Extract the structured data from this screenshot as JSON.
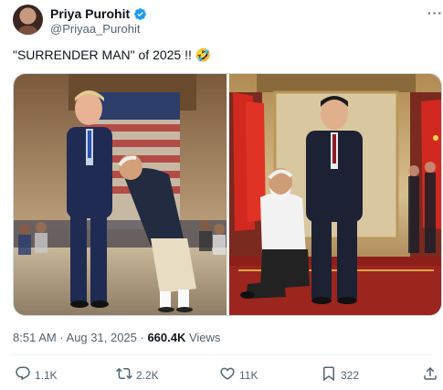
{
  "author": {
    "display_name": "Priya Purohit",
    "handle": "@Priyaa_Purohit",
    "verified_icon": "verified-badge-icon",
    "avatar_icon": "avatar"
  },
  "menu_icon": "more-options-icon",
  "tweet_text": "\"SURRENDER MAN\" of 2025 !! 🤣",
  "media": {
    "images": [
      "photo-left",
      "photo-right"
    ]
  },
  "meta": {
    "timestamp": "8:51 AM · Aug 31, 2025 · ",
    "views_count": "660.4K",
    "views_label": " Views"
  },
  "actions": {
    "reply_count": "1.1K",
    "repost_count": "2.2K",
    "like_count": "11K",
    "bookmark_count": "322"
  },
  "colors": {
    "verified": "#1d9bf0",
    "secondary_text": "#536471",
    "primary_text": "#0f1419"
  }
}
